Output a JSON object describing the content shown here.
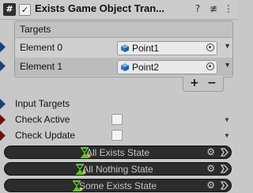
{
  "header": {
    "script_icon": "#",
    "enabled_check": "✓",
    "title": "Exists Game Object Tran...",
    "help_icon": "?",
    "presets_icon": "≢",
    "menu_icon": "⋮"
  },
  "targets": {
    "title": "Targets",
    "elements": [
      {
        "label": "Element 0",
        "value": "Point1"
      },
      {
        "label": "Element 1",
        "value": "Point2"
      }
    ],
    "add_label": "+",
    "remove_label": "−"
  },
  "fields": {
    "input_targets": "Input Targets",
    "check_active": "Check Active",
    "check_update": "Check Update"
  },
  "states": [
    {
      "label": "All Exists State"
    },
    {
      "label": "All Nothing State"
    },
    {
      "label": "Some Exists State"
    }
  ],
  "colors": {
    "port_blue": "#1f3f7a",
    "port_red": "#6e1010",
    "state_bar": "#2c2c2c",
    "hourglass_green": "#5cc72e"
  }
}
